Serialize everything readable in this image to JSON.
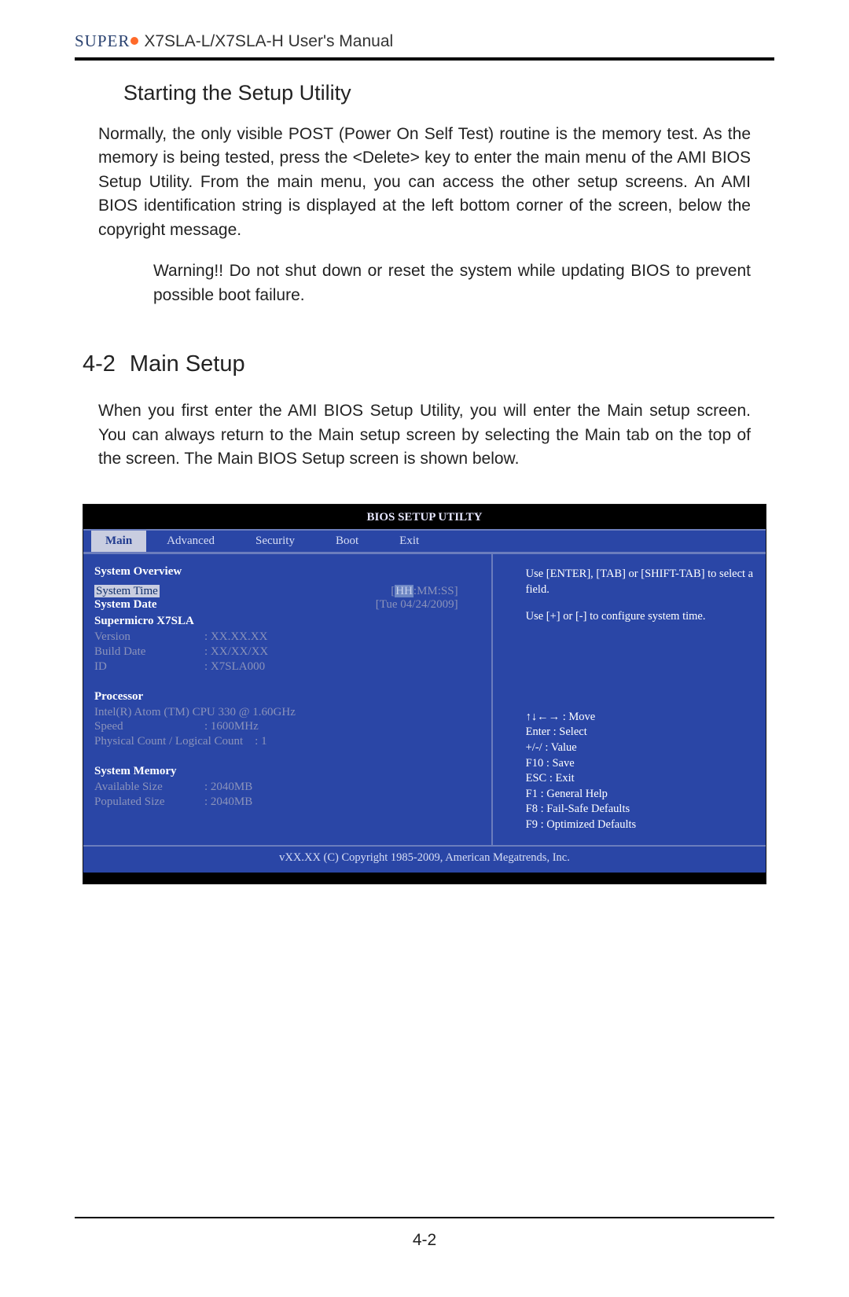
{
  "header": {
    "brand": "SUPER",
    "manual_title": "X7SLA-L/X7SLA-H User's Manual"
  },
  "section1": {
    "title": "Starting the Setup Utility",
    "para": "Normally, the only visible POST (Power On Self Test) routine is the memory test. As the memory is being tested, press the <Delete> key to enter the main menu of the AMI BIOS Setup Utility.  From the main menu, you can access the other setup screens. An AMI BIOS identification string is displayed at the left bottom corner of the screen, below the copyright message.",
    "warning_lead": "Warning!!",
    "warning_body": "  Do not shut down or reset the system while updating BIOS to prevent possible boot failure."
  },
  "section2": {
    "num": "4-2",
    "title": "Main Setup",
    "para": "When you first enter the AMI BIOS Setup Utility, you will enter the Main setup screen. You can always return to the Main setup screen by selecting the Main tab on the top of the screen. The Main BIOS Setup screen is shown below."
  },
  "bios": {
    "title": "BIOS SETUP UTILTY",
    "tabs": [
      "Main",
      "Advanced",
      "Security",
      "Boot",
      "Exit"
    ],
    "overview_heading": "System Overview",
    "time_label": "System Time",
    "time_value_prefix": "[",
    "time_value_hh": "HH",
    "time_value_suffix": ":MM:SS]",
    "date_label": "System Date",
    "date_value": "[Tue 04/24/2009]",
    "board": "Supermicro X7SLA",
    "version_label": "Version",
    "version_value": ": XX.XX.XX",
    "build_label": "Build Date",
    "build_value": ": XX/XX/XX",
    "id_label": "ID",
    "id_value": ": X7SLA000",
    "proc_heading": "Processor",
    "proc_name": "Intel(R)  Atom (TM)  CPU 330 @ 1.60GHz",
    "speed_label": "Speed",
    "speed_value": ": 1600MHz",
    "count_label": "Physical Count / Logical Count",
    "count_value": ": 1",
    "mem_heading": "System Memory",
    "avail_label": "Available Size",
    "avail_value": ": 2040MB",
    "pop_label": "Populated Size",
    "pop_value": ": 2040MB",
    "help1": "Use [ENTER], [TAB] or [SHIFT-TAB] to select a field.",
    "help2": "Use [+] or [-] to configure system time.",
    "keys": "↑↓←→ : Move\nEnter : Select\n+/-/ : Value\nF10 : Save\nESC : Exit\nF1 : General Help\nF8 : Fail-Safe Defaults\nF9 : Optimized Defaults",
    "footer": "vXX.XX (C) Copyright 1985-2009, American Megatrends, Inc."
  },
  "page_number": "4-2"
}
